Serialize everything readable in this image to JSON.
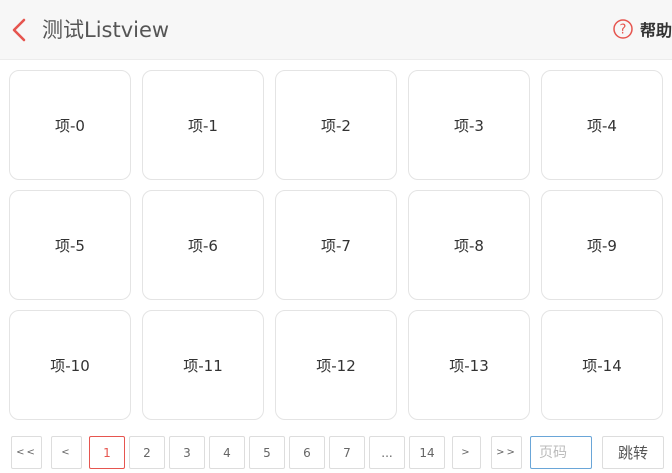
{
  "header": {
    "title": "测试Listview",
    "help_label": "帮助",
    "back_icon": "chevron-left-icon",
    "help_icon": "question-circle-icon",
    "accent_color": "#e6554f"
  },
  "grid": {
    "items": [
      "项-0",
      "项-1",
      "项-2",
      "项-3",
      "项-4",
      "项-5",
      "项-6",
      "项-7",
      "项-8",
      "项-9",
      "项-10",
      "项-11",
      "项-12",
      "项-13",
      "项-14"
    ]
  },
  "pager": {
    "first": "<<",
    "prev": "<",
    "pages": [
      "1",
      "2",
      "3",
      "4",
      "5",
      "6",
      "7"
    ],
    "ellipsis": "...",
    "last_page": "14",
    "next": ">",
    "last": ">>",
    "current_page": "1",
    "input_placeholder": "页码",
    "jump_label": "跳转"
  }
}
